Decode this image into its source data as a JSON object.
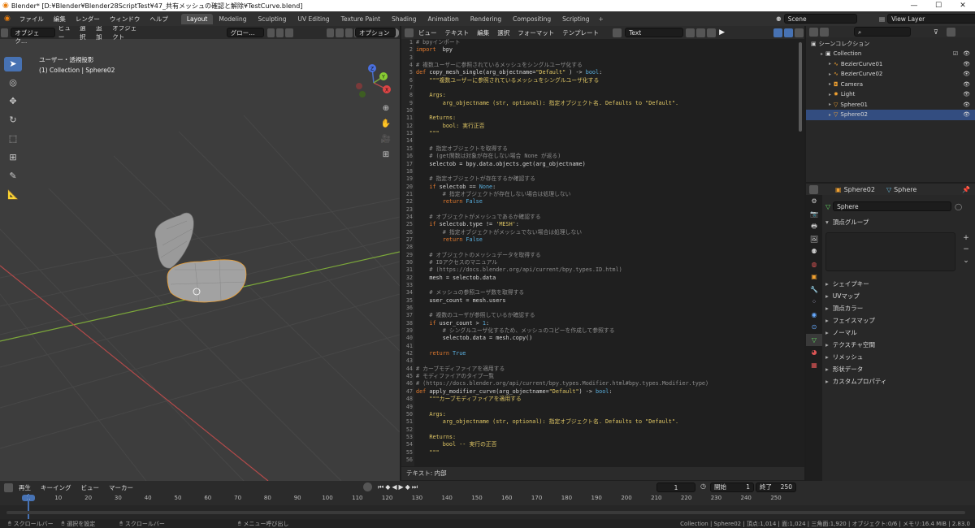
{
  "window": {
    "title": "Blender* [D:¥Blender¥Blender28ScriptTest¥47_共有メッシュの確認と解除¥TestCurve.blend]",
    "min": "—",
    "max": "☐",
    "close": "✕"
  },
  "menu": [
    "ファイル",
    "編集",
    "レンダー",
    "ウィンドウ",
    "ヘルプ"
  ],
  "workspaces": [
    "Layout",
    "Modeling",
    "Sculpting",
    "UV Editing",
    "Texture Paint",
    "Shading",
    "Animation",
    "Rendering",
    "Compositing",
    "Scripting"
  ],
  "workspace_active": "Layout",
  "scene": "Scene",
  "view_layer": "View Layer",
  "viewport": {
    "mode": "オブジェク…",
    "menus": [
      "ビュー",
      "選択",
      "追加",
      "オブジェクト"
    ],
    "orient": "グロー…",
    "options": "オプション",
    "overlay_title": "ユーザー・透視投影",
    "overlay_sub": "(1) Collection | Sphere02",
    "gizmo": {
      "x": "X",
      "y": "Y",
      "z": "Z"
    }
  },
  "text_editor": {
    "menus": [
      "ビュー",
      "テキスト",
      "編集",
      "選択",
      "フォーマット",
      "テンプレート"
    ],
    "text_name": "Text",
    "footer": "テキスト: 内部",
    "lines": [
      [
        [
          "cm",
          "# bpyインポート"
        ]
      ],
      [
        [
          "kw",
          "import"
        ],
        [
          "",
          "  bpy"
        ]
      ],
      [
        [
          "",
          ""
        ]
      ],
      [
        [
          "cm",
          "# 複数ユーザーに参照されているメッシュをシングルユーザ化する"
        ]
      ],
      [
        [
          "kw",
          "def"
        ],
        [
          "",
          " copy_mesh_single(arg_objectname="
        ],
        [
          "st",
          "\"Default\""
        ],
        [
          "",
          " ) -> "
        ],
        [
          "bl",
          "bool"
        ],
        [
          "",
          ":"
        ]
      ],
      [
        [
          "st",
          "    \"\"\"複数ユーザーに参照されているメッシュをシングルユーザ化する"
        ]
      ],
      [
        [
          "",
          ""
        ]
      ],
      [
        [
          "st",
          "    Args:"
        ]
      ],
      [
        [
          "st",
          "        arg_objectname (str, optional): 指定オブジェクト名. Defaults to \"Default\"."
        ]
      ],
      [
        [
          "",
          ""
        ]
      ],
      [
        [
          "st",
          "    Returns:"
        ]
      ],
      [
        [
          "st",
          "        bool: 実行正否"
        ]
      ],
      [
        [
          "st",
          "    \"\"\""
        ]
      ],
      [
        [
          "",
          ""
        ]
      ],
      [
        [
          "cm",
          "    # 指定オブジェクトを取得する"
        ]
      ],
      [
        [
          "cm",
          "    # (get関数は対象が存在しない場合 None が返る)"
        ]
      ],
      [
        [
          "",
          "    selectob = bpy.data.objects.get(arg_objectname)"
        ]
      ],
      [
        [
          "",
          ""
        ]
      ],
      [
        [
          "cm",
          "    # 指定オブジェクトが存在するか確認する"
        ]
      ],
      [
        [
          "kw",
          "    if"
        ],
        [
          "",
          " selectob == "
        ],
        [
          "bl",
          "None"
        ],
        [
          "",
          ":"
        ]
      ],
      [
        [
          "cm",
          "        # 指定オブジェクトが存在しない場合は処理しない"
        ]
      ],
      [
        [
          "kw",
          "        return "
        ],
        [
          "bl",
          "False"
        ]
      ],
      [
        [
          "",
          ""
        ]
      ],
      [
        [
          "cm",
          "    # オブジェクトがメッシュであるか確認する"
        ]
      ],
      [
        [
          "kw",
          "    if"
        ],
        [
          "",
          " selectob.type != "
        ],
        [
          "st",
          "'MESH'"
        ],
        [
          "",
          ":"
        ]
      ],
      [
        [
          "cm",
          "        # 指定オブジェクトがメッシュでない場合は処理しない"
        ]
      ],
      [
        [
          "kw",
          "        return "
        ],
        [
          "bl",
          "False"
        ]
      ],
      [
        [
          "",
          ""
        ]
      ],
      [
        [
          "cm",
          "    # オブジェクトのメッシュデータを取得する"
        ]
      ],
      [
        [
          "cm",
          "    # IDアクセスのマニュアル"
        ]
      ],
      [
        [
          "cm",
          "    # (https://docs.blender.org/api/current/bpy.types.ID.html)"
        ]
      ],
      [
        [
          "",
          "    mesh = selectob.data"
        ]
      ],
      [
        [
          "",
          ""
        ]
      ],
      [
        [
          "cm",
          "    # メッシュの参照ユーザ数を取得する"
        ]
      ],
      [
        [
          "",
          "    user_count = mesh.users"
        ]
      ],
      [
        [
          "",
          ""
        ]
      ],
      [
        [
          "cm",
          "    # 複数のユーザが参照しているか確認する"
        ]
      ],
      [
        [
          "kw",
          "    if"
        ],
        [
          "",
          " user_count > "
        ],
        [
          "bl",
          "1"
        ],
        [
          "",
          ":"
        ]
      ],
      [
        [
          "cm",
          "        # シングルユーザ化するため、メッシュのコピーを作成して参照する"
        ]
      ],
      [
        [
          "",
          "        selectob.data = mesh.copy()"
        ]
      ],
      [
        [
          "",
          ""
        ]
      ],
      [
        [
          "kw",
          "    return "
        ],
        [
          "bl",
          "True"
        ]
      ],
      [
        [
          "",
          ""
        ]
      ],
      [
        [
          "cm",
          "# カーブモディファイアを適用する"
        ]
      ],
      [
        [
          "cm",
          "# モディファイアのタイプ一覧"
        ]
      ],
      [
        [
          "cm",
          "# (https://docs.blender.org/api/current/bpy.types.Modifier.html#bpy.types.Modifier.type)"
        ]
      ],
      [
        [
          "kw",
          "def"
        ],
        [
          "",
          " apply_modifier_curve(arg_objectname="
        ],
        [
          "st",
          "\"Default\""
        ],
        [
          "",
          ") -> "
        ],
        [
          "bl",
          "bool"
        ],
        [
          "",
          ":"
        ]
      ],
      [
        [
          "st",
          "    \"\"\"カーブモディファイアを適用する"
        ]
      ],
      [
        [
          "",
          ""
        ]
      ],
      [
        [
          "st",
          "    Args:"
        ]
      ],
      [
        [
          "st",
          "        arg_objectname (str, optional): 指定オブジェクト名. Defaults to \"Default\"."
        ]
      ],
      [
        [
          "",
          ""
        ]
      ],
      [
        [
          "st",
          "    Returns:"
        ]
      ],
      [
        [
          "st",
          "        bool -- 実行の正否"
        ]
      ],
      [
        [
          "st",
          "    \"\"\""
        ]
      ],
      [
        [
          "",
          ""
        ]
      ]
    ]
  },
  "outliner": {
    "root": "シーンコレクション",
    "items": [
      {
        "label": "Collection",
        "depth": 1,
        "icon": "collection-icon"
      },
      {
        "label": "BezierCurve01",
        "depth": 2,
        "icon": "curve-icon"
      },
      {
        "label": "BezierCurve02",
        "depth": 2,
        "icon": "curve-icon"
      },
      {
        "label": "Camera",
        "depth": 2,
        "icon": "camera-icon"
      },
      {
        "label": "Light",
        "depth": 2,
        "icon": "light-icon"
      },
      {
        "label": "Sphere01",
        "depth": 2,
        "icon": "mesh-icon"
      },
      {
        "label": "Sphere02",
        "depth": 2,
        "icon": "mesh-icon"
      }
    ]
  },
  "properties": {
    "object": "Sphere02",
    "data": "Sphere",
    "mesh_name": "Sphere",
    "panels": [
      "頂点グループ",
      "シェイプキー",
      "UVマップ",
      "頂点カラー",
      "フェイスマップ",
      "ノーマル",
      "テクスチャ空間",
      "リメッシュ",
      "形状データ",
      "カスタムプロパティ"
    ]
  },
  "timeline": {
    "menus": [
      "再生",
      "キーイング",
      "ビュー",
      "マーカー"
    ],
    "current_frame": "1",
    "start_label": "開始",
    "start": "1",
    "end_label": "終了",
    "end": "250",
    "ticks": [
      "1",
      "10",
      "20",
      "30",
      "40",
      "50",
      "60",
      "70",
      "80",
      "90",
      "100",
      "110",
      "120",
      "130",
      "140",
      "150",
      "160",
      "170",
      "180",
      "190",
      "200",
      "210",
      "220",
      "230",
      "240",
      "250"
    ]
  },
  "status": {
    "left": [
      "スクロールバー",
      "選択を設定",
      "スクロールバー",
      "メニュー呼び出し"
    ],
    "right": "Collection | Sphere02 | 頂点:1,014 | 面:1,024 | 三角面:1,920 | オブジェクト:0/6 | メモリ:16.4 MiB | 2.83.0"
  },
  "colors": {
    "accent": "#4772b3",
    "x_axis": "#b34a4a",
    "y_axis": "#7ca83a"
  }
}
